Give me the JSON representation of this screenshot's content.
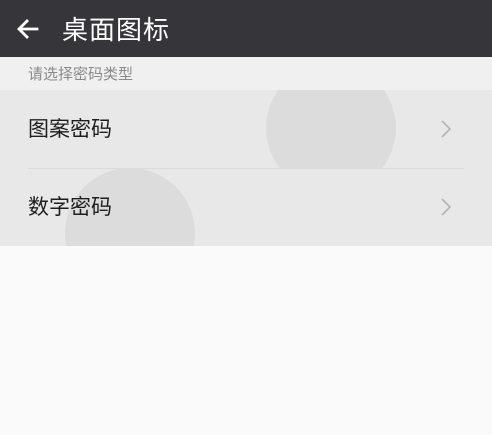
{
  "app_bar": {
    "title": "桌面图标",
    "back_icon": "arrow-left-icon"
  },
  "section_header": "请选择密码类型",
  "options": [
    {
      "label": "图案密码",
      "icon": "chevron-right-icon"
    },
    {
      "label": "数字密码",
      "icon": "chevron-right-icon"
    }
  ],
  "colors": {
    "app_bar_bg": "#36363a",
    "section_bg": "#f0f0f0",
    "list_bg": "#e8e8e8",
    "page_bg": "#fafafa"
  }
}
